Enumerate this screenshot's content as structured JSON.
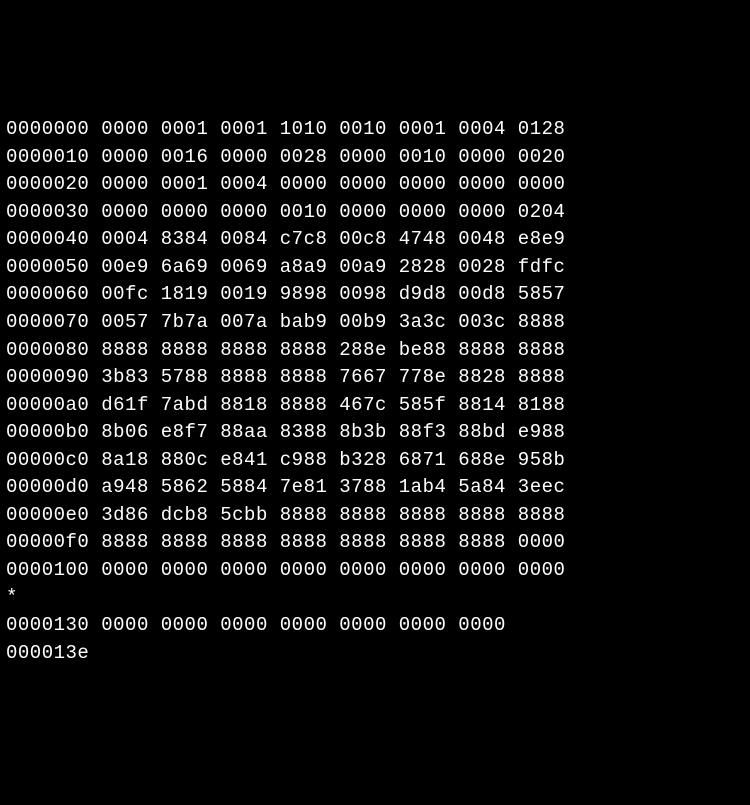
{
  "hexdump": {
    "lines": [
      {
        "offset": "0000000",
        "words": [
          "0000",
          "0001",
          "0001",
          "1010",
          "0010",
          "0001",
          "0004",
          "0128"
        ]
      },
      {
        "offset": "0000010",
        "words": [
          "0000",
          "0016",
          "0000",
          "0028",
          "0000",
          "0010",
          "0000",
          "0020"
        ]
      },
      {
        "offset": "0000020",
        "words": [
          "0000",
          "0001",
          "0004",
          "0000",
          "0000",
          "0000",
          "0000",
          "0000"
        ]
      },
      {
        "offset": "0000030",
        "words": [
          "0000",
          "0000",
          "0000",
          "0010",
          "0000",
          "0000",
          "0000",
          "0204"
        ]
      },
      {
        "offset": "0000040",
        "words": [
          "0004",
          "8384",
          "0084",
          "c7c8",
          "00c8",
          "4748",
          "0048",
          "e8e9"
        ]
      },
      {
        "offset": "0000050",
        "words": [
          "00e9",
          "6a69",
          "0069",
          "a8a9",
          "00a9",
          "2828",
          "0028",
          "fdfc"
        ]
      },
      {
        "offset": "0000060",
        "words": [
          "00fc",
          "1819",
          "0019",
          "9898",
          "0098",
          "d9d8",
          "00d8",
          "5857"
        ]
      },
      {
        "offset": "0000070",
        "words": [
          "0057",
          "7b7a",
          "007a",
          "bab9",
          "00b9",
          "3a3c",
          "003c",
          "8888"
        ]
      },
      {
        "offset": "0000080",
        "words": [
          "8888",
          "8888",
          "8888",
          "8888",
          "288e",
          "be88",
          "8888",
          "8888"
        ]
      },
      {
        "offset": "0000090",
        "words": [
          "3b83",
          "5788",
          "8888",
          "8888",
          "7667",
          "778e",
          "8828",
          "8888"
        ]
      },
      {
        "offset": "00000a0",
        "words": [
          "d61f",
          "7abd",
          "8818",
          "8888",
          "467c",
          "585f",
          "8814",
          "8188"
        ]
      },
      {
        "offset": "00000b0",
        "words": [
          "8b06",
          "e8f7",
          "88aa",
          "8388",
          "8b3b",
          "88f3",
          "88bd",
          "e988"
        ]
      },
      {
        "offset": "00000c0",
        "words": [
          "8a18",
          "880c",
          "e841",
          "c988",
          "b328",
          "6871",
          "688e",
          "958b"
        ]
      },
      {
        "offset": "00000d0",
        "words": [
          "a948",
          "5862",
          "5884",
          "7e81",
          "3788",
          "1ab4",
          "5a84",
          "3eec"
        ]
      },
      {
        "offset": "00000e0",
        "words": [
          "3d86",
          "dcb8",
          "5cbb",
          "8888",
          "8888",
          "8888",
          "8888",
          "8888"
        ]
      },
      {
        "offset": "00000f0",
        "words": [
          "8888",
          "8888",
          "8888",
          "8888",
          "8888",
          "8888",
          "8888",
          "0000"
        ]
      },
      {
        "offset": "0000100",
        "words": [
          "0000",
          "0000",
          "0000",
          "0000",
          "0000",
          "0000",
          "0000",
          "0000"
        ]
      }
    ],
    "squeeze": "*",
    "trailing": {
      "line": {
        "offset": "0000130",
        "words": [
          "0000",
          "0000",
          "0000",
          "0000",
          "0000",
          "0000",
          "0000"
        ]
      },
      "end_offset": "000013e"
    }
  }
}
